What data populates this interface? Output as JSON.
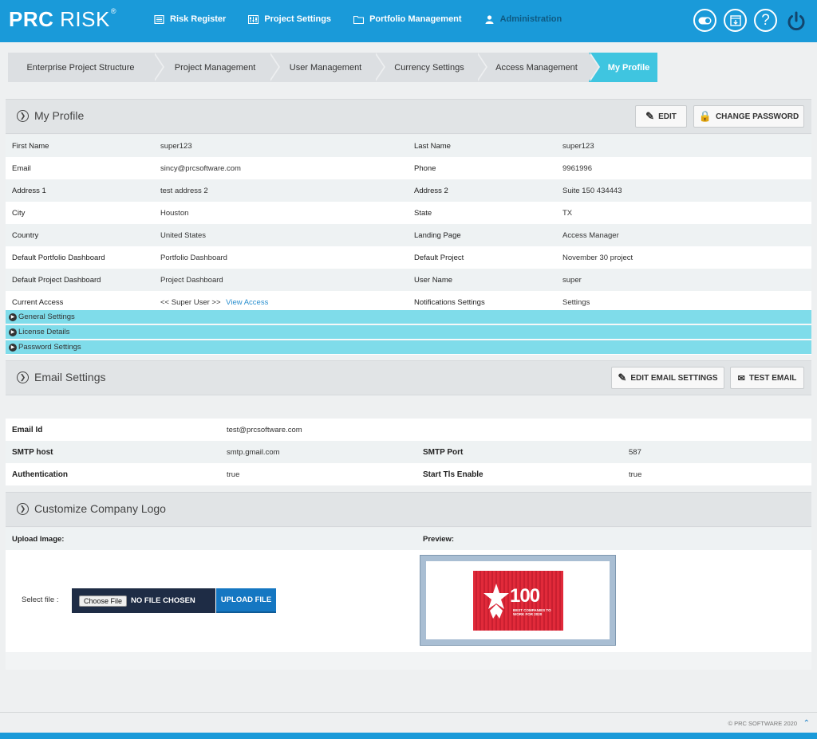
{
  "brand": {
    "logo_bold": "PRC",
    "logo_regular": "RISK",
    "logo_mark": "®"
  },
  "nav": [
    {
      "label": "Risk Register",
      "icon": "list-icon"
    },
    {
      "label": "Project Settings",
      "icon": "sliders-icon"
    },
    {
      "label": "Portfolio Management",
      "icon": "folder-icon"
    },
    {
      "label": "Administration",
      "icon": "user-icon"
    }
  ],
  "top_icons": [
    "toggle-icon",
    "download-icon",
    "help-icon",
    "power-icon"
  ],
  "breadcrumb": [
    {
      "label": "Enterprise Project Structure"
    },
    {
      "label": "Project Management"
    },
    {
      "label": "User Management"
    },
    {
      "label": "Currency Settings"
    },
    {
      "label": "Access Management"
    },
    {
      "label": "My Profile",
      "active": true
    }
  ],
  "profile": {
    "title": "My Profile",
    "edit_label": "EDIT",
    "change_password_label": "CHANGE PASSWORD",
    "rows": [
      {
        "l1": "First Name",
        "v1": "super123",
        "l2": "Last Name",
        "v2": "super123"
      },
      {
        "l1": "Email",
        "v1": "sincy@prcsoftware.com",
        "l2": "Phone",
        "v2": "9961996"
      },
      {
        "l1": "Address 1",
        "v1": "test address 2",
        "l2": "Address 2",
        "v2": "Suite 150 434443"
      },
      {
        "l1": "City",
        "v1": "Houston",
        "l2": "State",
        "v2": "TX"
      },
      {
        "l1": "Country",
        "v1": "United States",
        "l2": "Landing Page",
        "v2": "Access Manager"
      },
      {
        "l1": "Default Portfolio Dashboard",
        "v1": "Portfolio Dashboard",
        "l2": "Default Project",
        "v2": "November 30 project"
      },
      {
        "l1": "Default Project Dashboard",
        "v1": "Project Dashboard",
        "l2": "User Name",
        "v2": "super"
      }
    ],
    "current_access_label": "Current Access",
    "current_access_value": "<< Super User >>",
    "view_access_link": "View Access",
    "notifications_label": "Notifications Settings",
    "notifications_link": "Settings",
    "expanders": [
      "General Settings",
      "License Details",
      "Password Settings"
    ]
  },
  "email": {
    "title": "Email Settings",
    "edit_label": "EDIT EMAIL SETTINGS",
    "test_label": "TEST EMAIL",
    "email_id_label": "Email Id",
    "email_id_value": "test@prcsoftware.com",
    "smtp_host_label": "SMTP host",
    "smtp_host_value": "smtp.gmail.com",
    "smtp_port_label": "SMTP Port",
    "smtp_port_value": "587",
    "auth_label": "Authentication",
    "auth_value": "true",
    "tls_label": "Start Tls Enable",
    "tls_value": "true"
  },
  "logo_section": {
    "title": "Customize Company Logo",
    "upload_label": "Upload Image:",
    "preview_label": "Preview:",
    "select_file_label": "Select file :",
    "choose_file_label": "Choose File",
    "no_file_label": "NO FILE CHOSEN",
    "upload_button": "UPLOAD FILE",
    "badge_number": "100",
    "badge_caption": "BEST COMPANIES TO WORK FOR 2020"
  },
  "footer": {
    "copyright": "© PRC SOFTWARE 2020"
  }
}
